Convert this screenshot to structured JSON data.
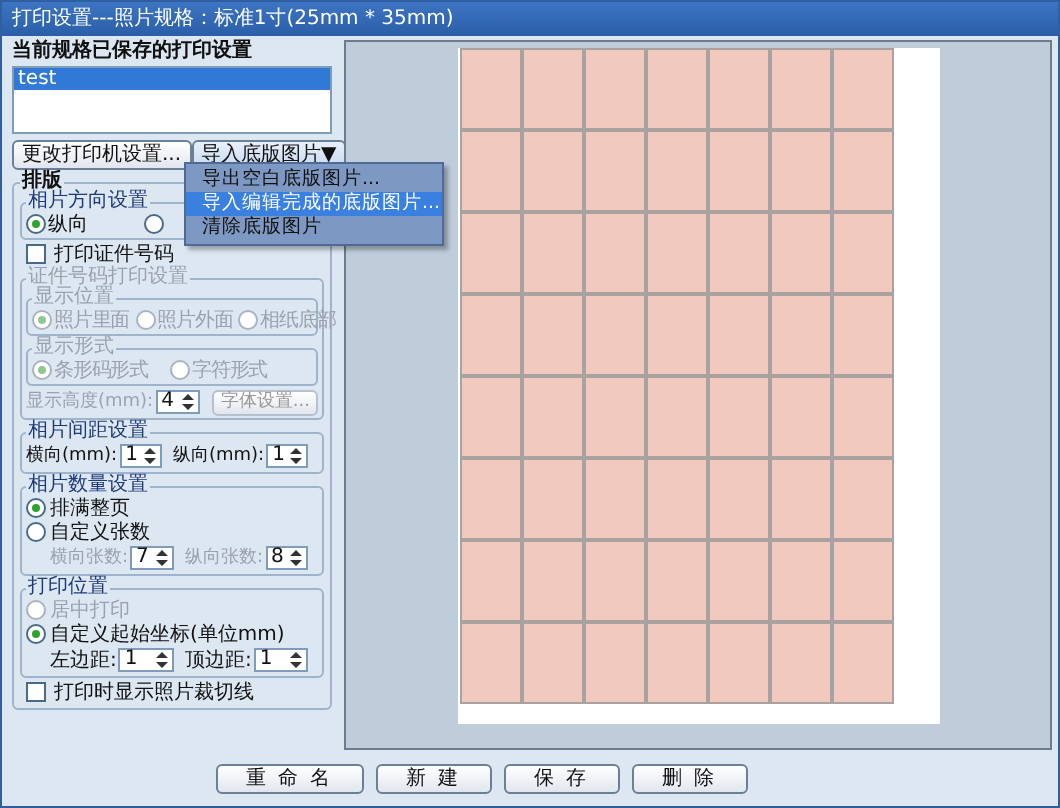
{
  "window": {
    "title": "打印设置---照片规格：标准1寸(25mm * 35mm)"
  },
  "saved": {
    "heading": "当前规格已保存的打印设置",
    "items": [
      {
        "label": "test",
        "selected": true
      }
    ]
  },
  "printer_button": "更改打印机设置...",
  "import_button": "导入底版图片▼",
  "import_menu": [
    {
      "label": "导出空白底版图片...",
      "selected": false
    },
    {
      "label": "导入编辑完成的底版图片...",
      "selected": true
    },
    {
      "label": "清除底版图片",
      "selected": false
    }
  ],
  "layout": {
    "title": "排版",
    "orientation": {
      "title": "相片方向设置",
      "options": [
        {
          "label": "纵向",
          "selected": true
        },
        {
          "selected": false
        }
      ]
    },
    "print_id": {
      "label": "打印证件号码",
      "checked": false
    },
    "id_settings": {
      "title": "证件号码打印设置",
      "disabled": true,
      "position": {
        "title": "显示位置",
        "options": [
          {
            "label": "照片里面",
            "selected": true
          },
          {
            "label": "照片外面",
            "selected": false
          },
          {
            "label": "相纸底部",
            "selected": false
          }
        ]
      },
      "format": {
        "title": "显示形式",
        "options": [
          {
            "label": "条形码形式",
            "selected": true
          },
          {
            "label": "字符形式",
            "selected": false
          }
        ]
      },
      "height_label": "显示高度(mm):",
      "height_value": "4",
      "font_button": "字体设置..."
    },
    "spacing": {
      "title": "相片间距设置",
      "fields": [
        {
          "label": "横向(mm):",
          "value": "1"
        },
        {
          "label": "纵向(mm):",
          "value": "1"
        }
      ]
    },
    "count": {
      "title": "相片数量设置",
      "options": [
        {
          "label": "排满整页",
          "selected": true
        },
        {
          "label": "自定义张数",
          "selected": false
        }
      ],
      "fields_disabled": true,
      "fields": [
        {
          "label": "横向张数:",
          "value": "7"
        },
        {
          "label": "纵向张数:",
          "value": "8"
        }
      ]
    },
    "position": {
      "title": "打印位置",
      "options": [
        {
          "label": "居中打印",
          "selected": false,
          "disabled": true
        },
        {
          "label": "自定义起始坐标(单位mm)",
          "selected": true,
          "disabled": false
        }
      ],
      "fields": [
        {
          "label": "左边距:",
          "value": "1"
        },
        {
          "label": "顶边距:",
          "value": "1"
        }
      ]
    },
    "cut_lines": {
      "label": "打印时显示照片裁切线",
      "checked": false
    }
  },
  "buttons": [
    "重命名",
    "新建",
    "保存",
    "删除"
  ]
}
